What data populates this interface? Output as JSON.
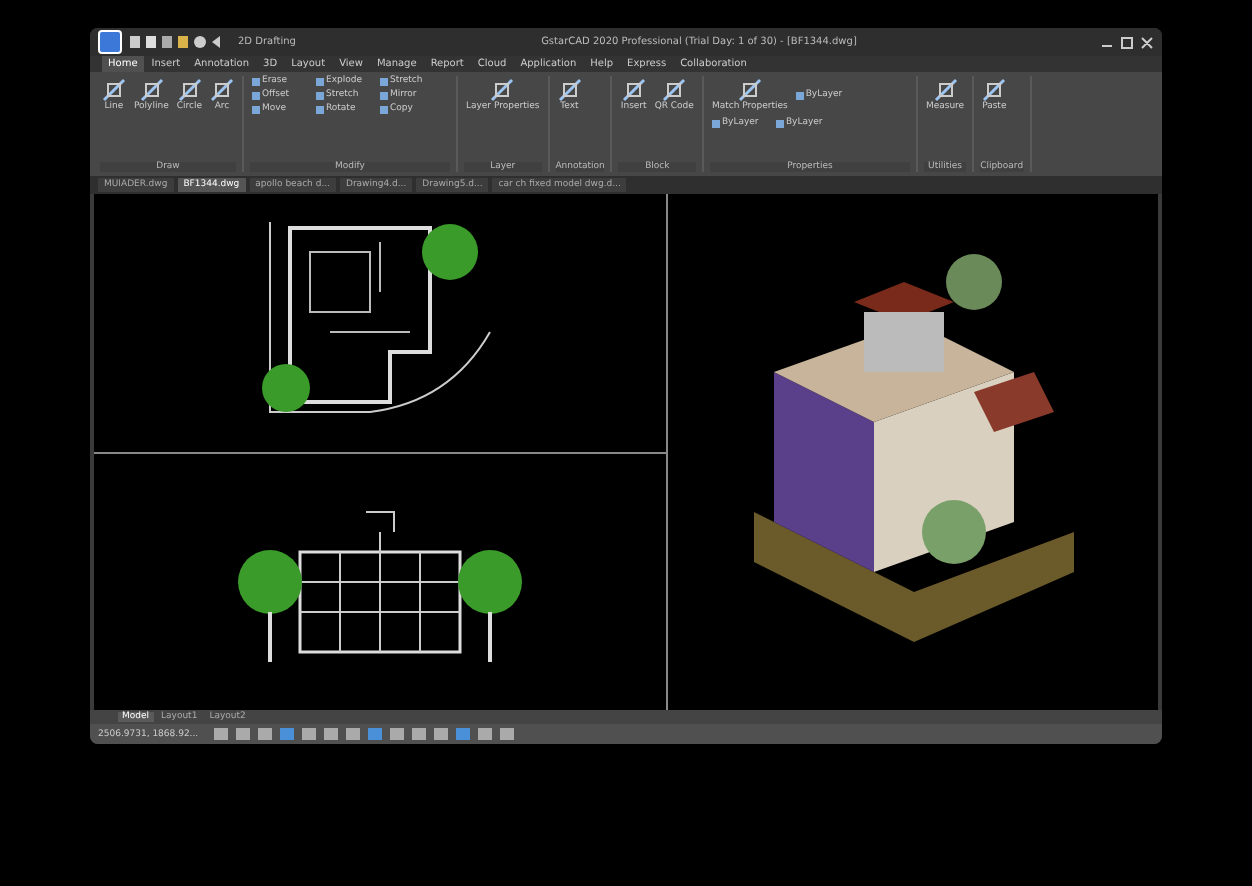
{
  "window": {
    "title": "GstarCAD 2020 Professional (Trial Day: 1 of 30) - [BF1344.dwg]",
    "workspace": "2D Drafting"
  },
  "ribbon_tabs": [
    {
      "label": "Home",
      "selected": true
    },
    {
      "label": "Insert",
      "selected": false
    },
    {
      "label": "Annotation",
      "selected": false
    },
    {
      "label": "3D",
      "selected": false
    },
    {
      "label": "Layout",
      "selected": false
    },
    {
      "label": "View",
      "selected": false
    },
    {
      "label": "Manage",
      "selected": false
    },
    {
      "label": "Report",
      "selected": false
    },
    {
      "label": "Cloud",
      "selected": false
    },
    {
      "label": "Application",
      "selected": false
    },
    {
      "label": "Help",
      "selected": false
    },
    {
      "label": "Express",
      "selected": false
    },
    {
      "label": "Collaboration",
      "selected": false
    }
  ],
  "panels": [
    {
      "title": "Draw",
      "tools": [
        {
          "label": "Line",
          "kind": "big"
        },
        {
          "label": "Polyline",
          "kind": "big"
        },
        {
          "label": "Circle",
          "kind": "big"
        },
        {
          "label": "Arc",
          "kind": "big"
        }
      ]
    },
    {
      "title": "Modify",
      "tools": [
        {
          "label": "Erase",
          "kind": "small"
        },
        {
          "label": "Explode",
          "kind": "small"
        },
        {
          "label": "Stretch",
          "kind": "small"
        },
        {
          "label": "Offset",
          "kind": "small"
        },
        {
          "label": "Stretch",
          "kind": "small"
        },
        {
          "label": "Mirror",
          "kind": "small"
        },
        {
          "label": "Move",
          "kind": "small"
        },
        {
          "label": "Rotate",
          "kind": "small"
        },
        {
          "label": "Copy",
          "kind": "small"
        }
      ]
    },
    {
      "title": "Layer",
      "tools": [
        {
          "label": "Layer Properties",
          "kind": "big"
        }
      ]
    },
    {
      "title": "Annotation",
      "tools": [
        {
          "label": "Text",
          "kind": "big"
        }
      ]
    },
    {
      "title": "Block",
      "tools": [
        {
          "label": "Insert",
          "kind": "big"
        },
        {
          "label": "QR Code",
          "kind": "big"
        }
      ]
    },
    {
      "title": "Properties",
      "tools": [
        {
          "label": "Match Properties",
          "kind": "big"
        },
        {
          "label": "ByLayer",
          "kind": "small"
        },
        {
          "label": "ByLayer",
          "kind": "small"
        },
        {
          "label": "ByLayer",
          "kind": "small"
        }
      ]
    },
    {
      "title": "Utilities",
      "tools": [
        {
          "label": "Measure",
          "kind": "big"
        }
      ]
    },
    {
      "title": "Clipboard",
      "tools": [
        {
          "label": "Paste",
          "kind": "big"
        }
      ]
    }
  ],
  "doc_tabs": [
    {
      "label": "MUIADER.dwg",
      "selected": false
    },
    {
      "label": "BF1344.dwg",
      "selected": true
    },
    {
      "label": "apollo beach d...",
      "selected": false
    },
    {
      "label": "Drawing4.d...",
      "selected": false
    },
    {
      "label": "Drawing5.d...",
      "selected": false
    },
    {
      "label": "car ch fixed model dwg.d...",
      "selected": false
    }
  ],
  "layout_tabs": [
    {
      "label": "Model",
      "selected": true
    },
    {
      "label": "Layout1",
      "selected": false
    },
    {
      "label": "Layout2",
      "selected": false
    }
  ],
  "status_bar": {
    "coordinates": "2506.9731, 1868.92..."
  }
}
